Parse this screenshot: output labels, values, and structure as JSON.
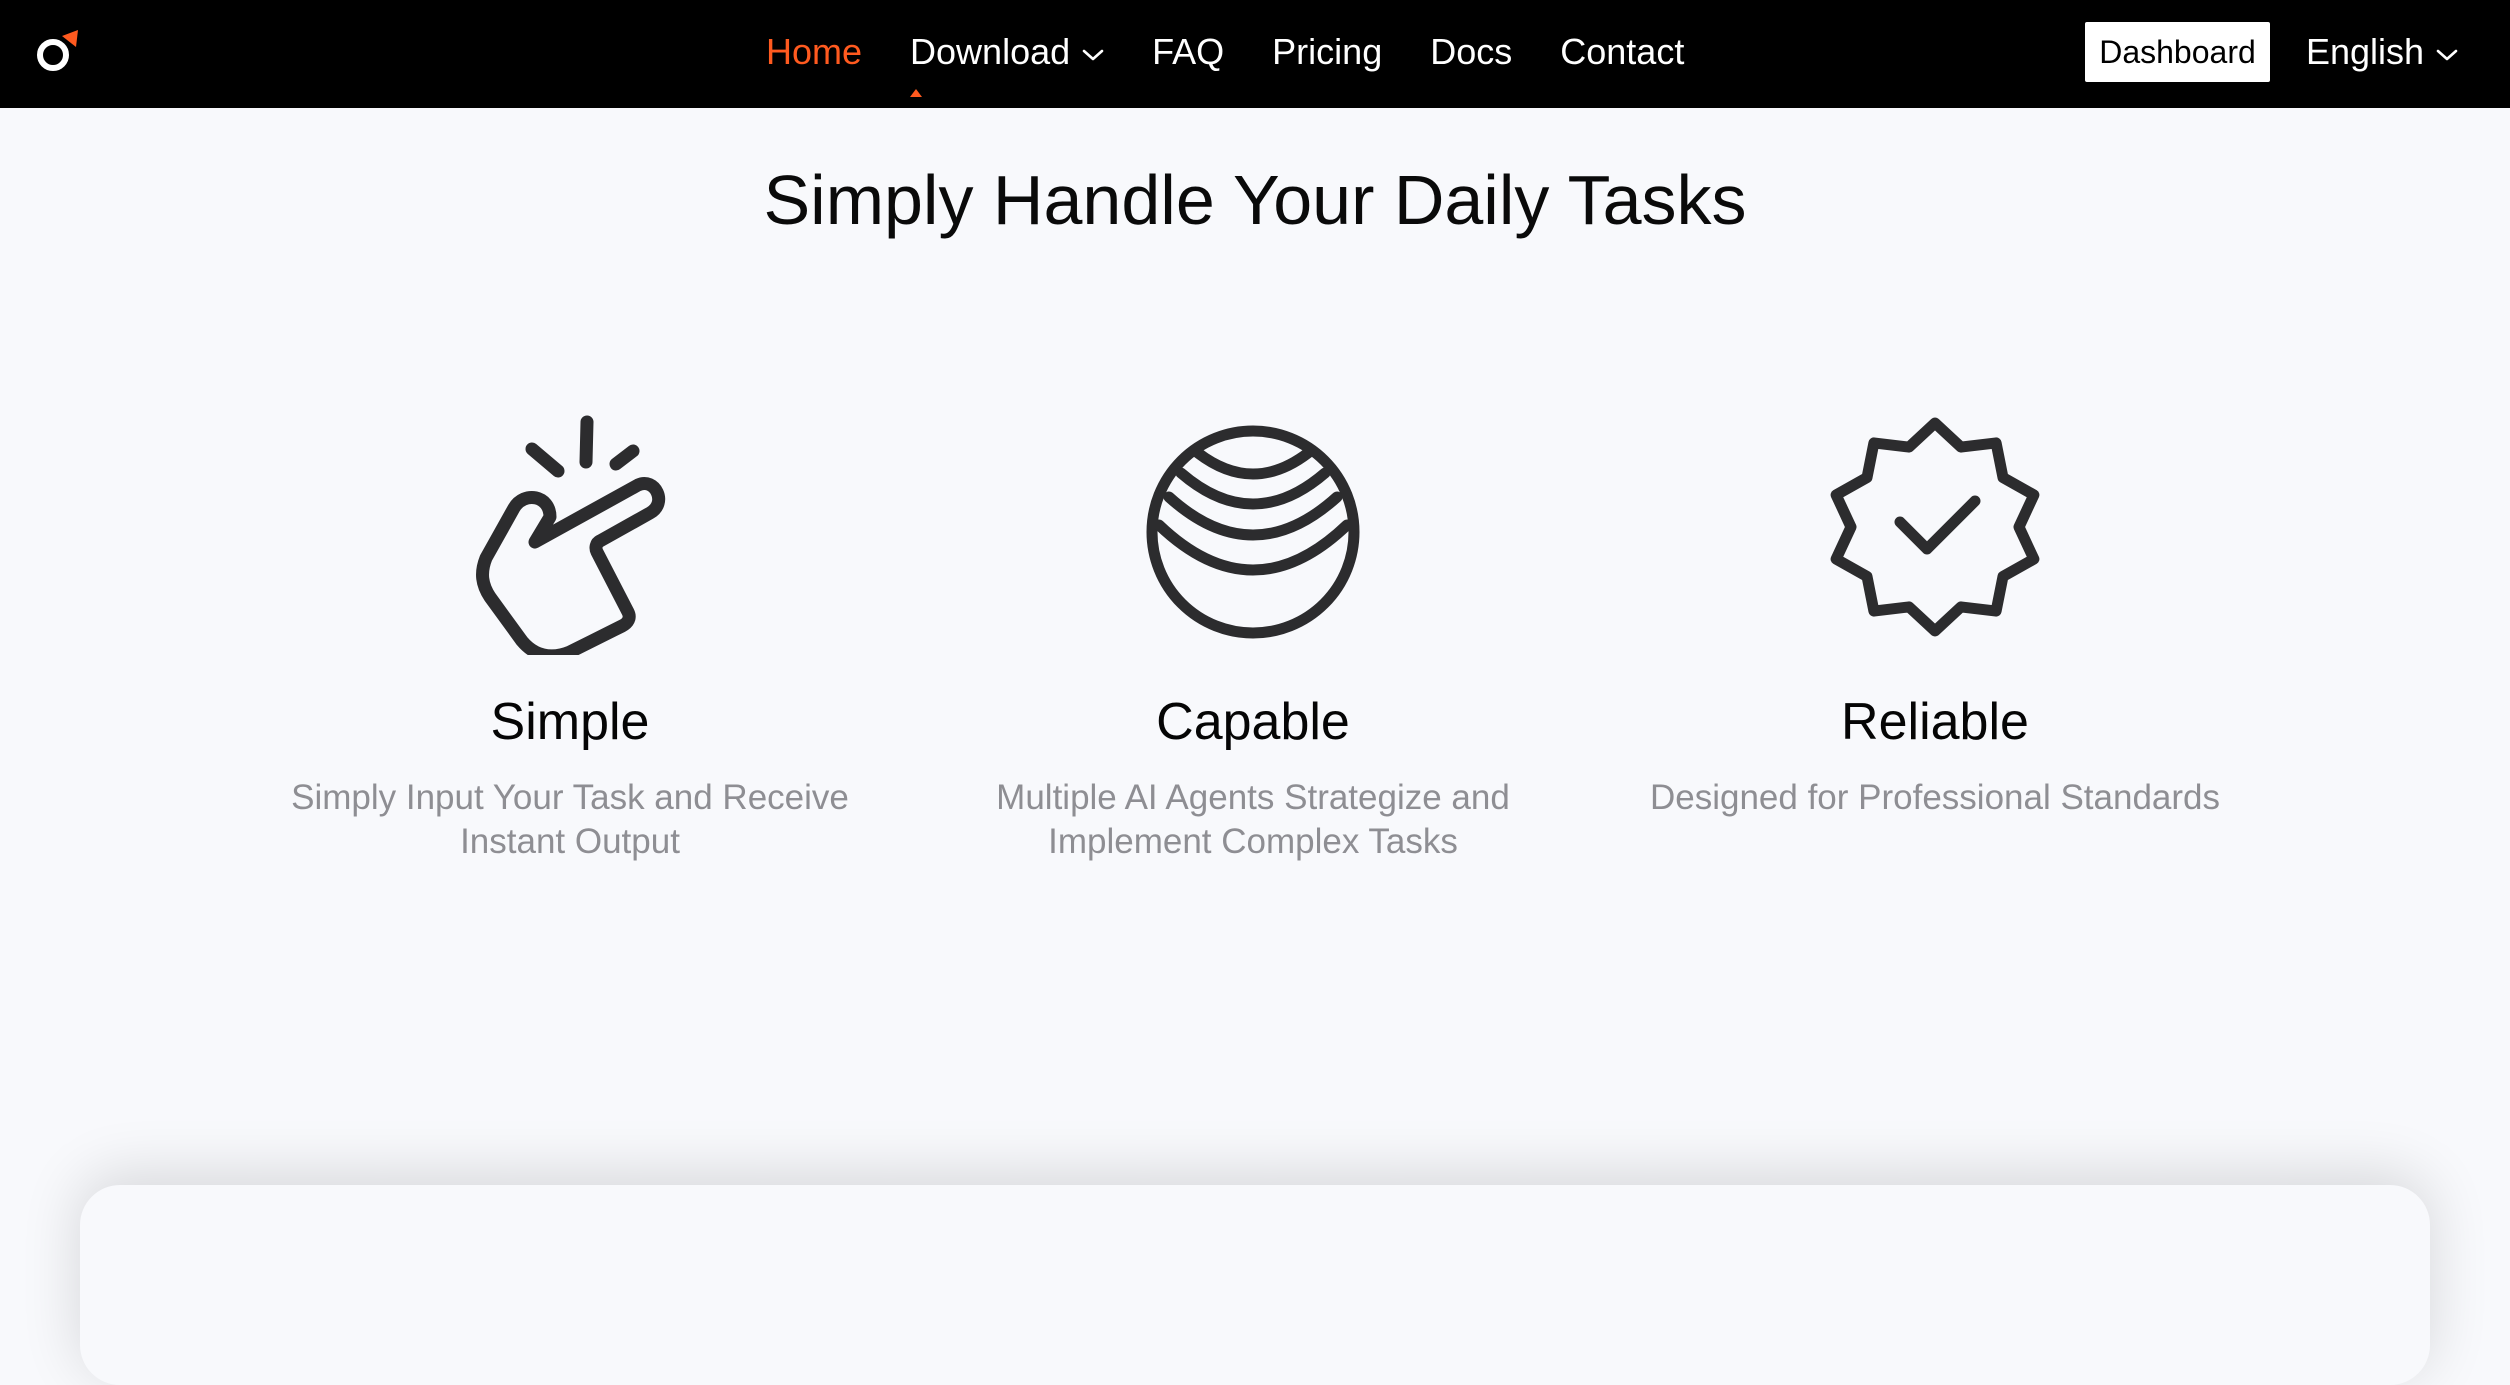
{
  "navbar": {
    "logo": {
      "name": "logo-icon",
      "accent": "#ff5a1f"
    },
    "links": [
      {
        "label": "Home",
        "active": true
      },
      {
        "label": "Download",
        "has_dropdown": true
      },
      {
        "label": "FAQ"
      },
      {
        "label": "Pricing"
      },
      {
        "label": "Docs"
      },
      {
        "label": "Contact"
      }
    ],
    "dashboard_label": "Dashboard",
    "language_label": "English"
  },
  "main": {
    "title": "Simply Handle Your Daily Tasks",
    "features": [
      {
        "icon": "finger-snap-icon",
        "title": "Simple",
        "description": "Simply Input Your Task and Receive Instant Output"
      },
      {
        "icon": "globe-sphere-icon",
        "title": "Capable",
        "description": "Multiple AI Agents Strategize and Implement Complex Tasks"
      },
      {
        "icon": "verified-badge-icon",
        "title": "Reliable",
        "description": "Designed for Professional Standards"
      }
    ]
  },
  "colors": {
    "accent": "#ff5a1f",
    "nav_bg": "#000000",
    "page_bg": "#f8f9fc",
    "icon_stroke": "#2c2c2e",
    "muted_text": "#8e8e93"
  }
}
